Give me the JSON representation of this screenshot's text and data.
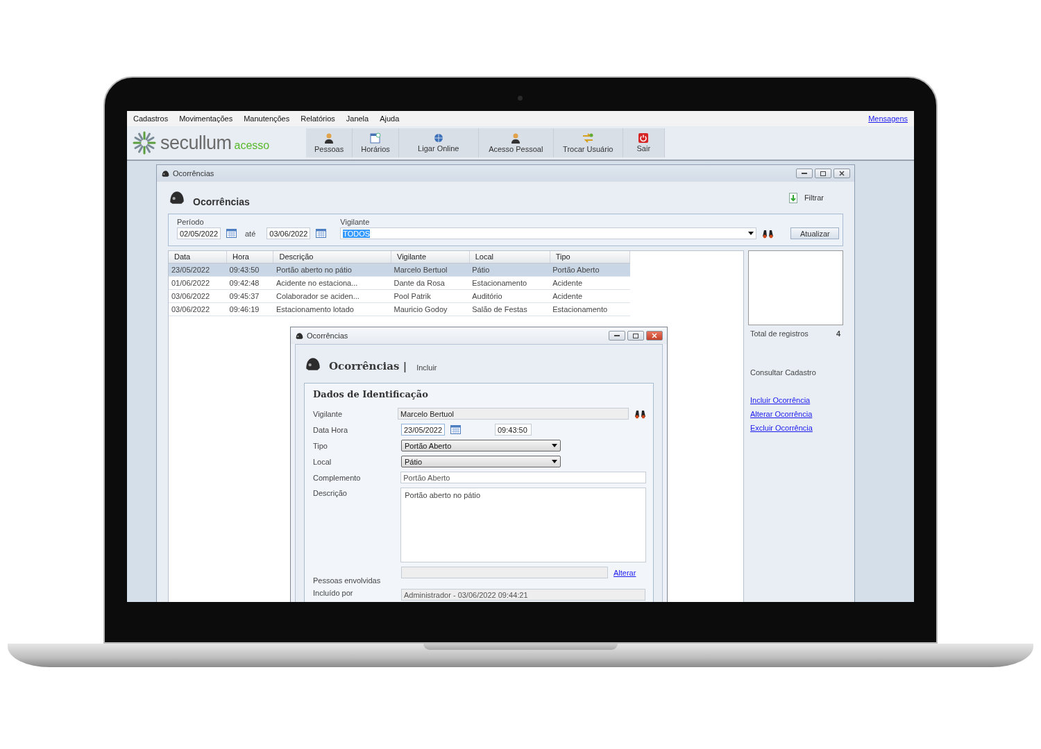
{
  "menu": [
    {
      "label": "Cadastros"
    },
    {
      "label": "Movimentações"
    },
    {
      "label": "Manutenções"
    },
    {
      "label": "Relatórios"
    },
    {
      "label": "Janela"
    },
    {
      "label": "Ajuda"
    }
  ],
  "messages_link": "Mensagens",
  "logo": {
    "name": "secullum",
    "suffix": "acesso"
  },
  "toolbar": [
    {
      "label": "Pessoas",
      "kind": "person"
    },
    {
      "label": "Horários",
      "kind": "schedule"
    },
    {
      "label": "Ligar Online",
      "kind": "globe"
    },
    {
      "label": "Acesso Pessoal",
      "kind": "person"
    },
    {
      "label": "Trocar Usuário",
      "kind": "swap"
    },
    {
      "label": "Sair",
      "kind": "power"
    }
  ],
  "window": {
    "title": "Ocorrências",
    "heading": "Ocorrências",
    "filter_button": "Filtrar",
    "filters": {
      "period_label": "Período",
      "start": "02/05/2022",
      "between": "até",
      "end": "03/06/2022",
      "guard_label": "Vigilante",
      "guard_value": "TODOS",
      "guard_value_selected": true,
      "update_button": "Atualizar"
    },
    "table": {
      "columns": [
        "Data",
        "Hora",
        "Descrição",
        "Vigilante",
        "Local",
        "Tipo"
      ],
      "rows": [
        {
          "cells": [
            "23/05/2022",
            "09:43:50",
            "Portão aberto no pátio",
            "Marcelo Bertuol",
            "Pátio",
            "Portão Aberto"
          ],
          "selected": true
        },
        {
          "cells": [
            "01/06/2022",
            "09:42:48",
            "Acidente no estaciona...",
            "Dante da Rosa",
            "Estacionamento",
            "Acidente"
          ],
          "selected": false
        },
        {
          "cells": [
            "03/06/2022",
            "09:45:37",
            "Colaborador se aciden...",
            "Pool Patrik",
            "Auditório",
            "Acidente"
          ],
          "selected": false
        },
        {
          "cells": [
            "03/06/2022",
            "09:46:19",
            "Estacionamento lotado",
            "Mauricio Godoy",
            "Salão de Festas",
            "Estacionamento"
          ],
          "selected": false
        }
      ]
    },
    "side": {
      "total_label": "Total de registros",
      "total": "4",
      "consult": "Consultar Cadastro",
      "links": [
        "Incluir Ocorrência",
        "Alterar Ocorrência",
        "Excluir Ocorrência"
      ]
    }
  },
  "dialog": {
    "title": "Ocorrências",
    "heading": "Ocorrências |",
    "mode": "Incluir",
    "section": "Dados de Identificação",
    "fields": [
      {
        "label": "Vigilante",
        "kind": "search",
        "value": "Marcelo Bertuol"
      },
      {
        "label": "Data Hora",
        "kind": "datetime",
        "value": "23/05/2022",
        "time": "09:43:50"
      },
      {
        "label": "Tipo",
        "kind": "select",
        "value": "Portão Aberto"
      },
      {
        "label": "Local",
        "kind": "select",
        "value": "Pátio"
      },
      {
        "label": "Complemento",
        "kind": "text",
        "value": "Portão Aberto"
      },
      {
        "label": "Descrição",
        "kind": "textarea",
        "value": "Portão aberto no pátio"
      },
      {
        "label": "Pessoas envolvidas",
        "kind": "link",
        "link": "Alterar"
      },
      {
        "label": "Incluído por",
        "kind": "readonly",
        "value": "Administrador - 03/06/2022 09:44:21"
      }
    ]
  }
}
